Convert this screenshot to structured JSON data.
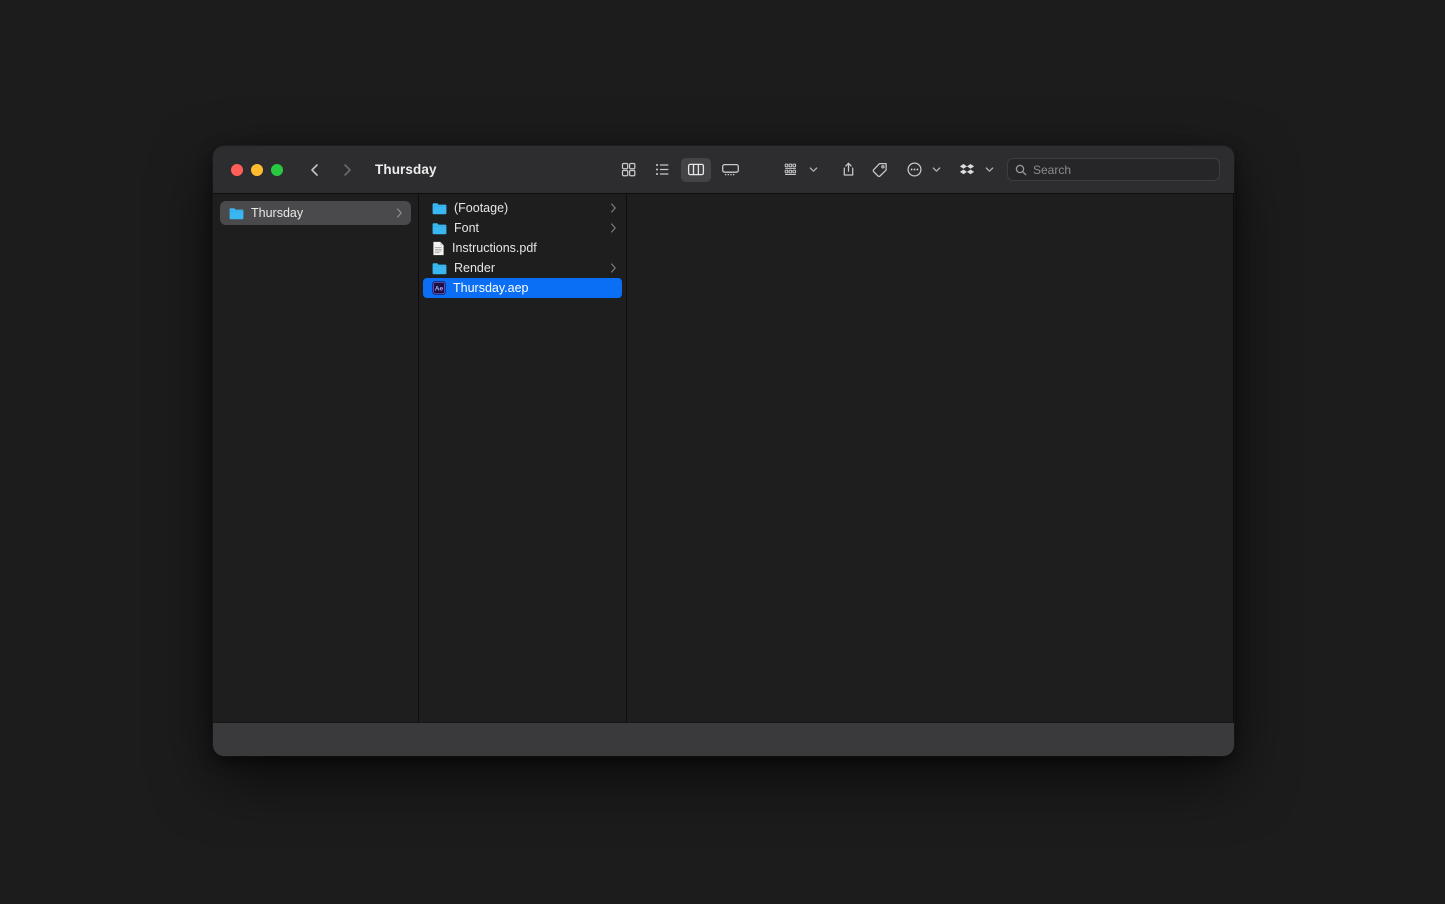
{
  "window": {
    "title": "Thursday",
    "traffic_lights": [
      {
        "name": "close",
        "color": "#ff5f57"
      },
      {
        "name": "minimize",
        "color": "#febc2e"
      },
      {
        "name": "maximize",
        "color": "#28c840"
      }
    ]
  },
  "toolbar": {
    "back_icon": "chevron-left-icon",
    "forward_icon": "chevron-right-icon",
    "view_modes": [
      {
        "name": "icon-view",
        "icon": "grid-icon",
        "active": false
      },
      {
        "name": "list-view",
        "icon": "list-icon",
        "active": false
      },
      {
        "name": "column-view",
        "icon": "columns-icon",
        "active": true
      },
      {
        "name": "gallery-view",
        "icon": "gallery-icon",
        "active": false
      }
    ],
    "actions": [
      {
        "name": "group-by",
        "icon": "group-icon",
        "has_chevron": true
      },
      {
        "name": "share",
        "icon": "share-icon",
        "has_chevron": false
      },
      {
        "name": "tags",
        "icon": "tag-icon",
        "has_chevron": false
      },
      {
        "name": "more-actions",
        "icon": "ellipsis-circle-icon",
        "has_chevron": true
      }
    ],
    "dropbox": {
      "name": "dropbox",
      "icon": "dropbox-icon",
      "has_chevron": true
    }
  },
  "search": {
    "placeholder": "Search",
    "value": "",
    "icon": "search-icon"
  },
  "sidebar": {
    "items": [
      {
        "label": "Thursday",
        "icon": "folder-icon",
        "selected": true,
        "has_chevron": true
      }
    ]
  },
  "file_list": {
    "items": [
      {
        "name": "(Footage)",
        "kind": "folder",
        "icon": "folder-icon",
        "selected": false,
        "has_chevron": true
      },
      {
        "name": "Font",
        "kind": "folder",
        "icon": "folder-icon",
        "selected": false,
        "has_chevron": true
      },
      {
        "name": "Instructions.pdf",
        "kind": "file",
        "icon": "pdf-document-icon",
        "selected": false,
        "has_chevron": false
      },
      {
        "name": "Render",
        "kind": "folder",
        "icon": "folder-icon",
        "selected": false,
        "has_chevron": true
      },
      {
        "name": "Thursday.aep",
        "kind": "file",
        "icon": "after-effects-icon",
        "selected": true,
        "has_chevron": false
      }
    ]
  },
  "colors": {
    "selection_blue": "#0a6ff5",
    "folder_blue": "#3ab7f0",
    "sidebar_selection": "#4a4a4c",
    "titlebar": "#2d2d2f",
    "content_bg": "#1e1e1e",
    "bottom_bar": "#3a3a3c"
  }
}
